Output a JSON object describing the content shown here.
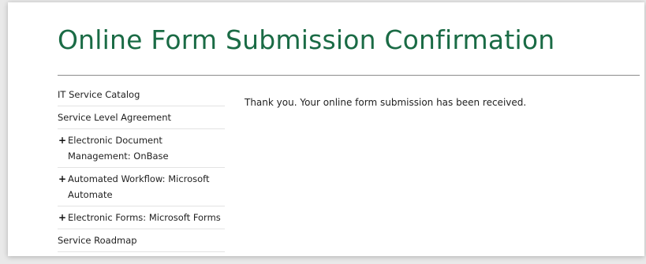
{
  "header": {
    "title": "Online Form Submission Confirmation",
    "accent_color": "#1a6b45"
  },
  "sidebar": {
    "items": [
      {
        "label": "IT Service Catalog",
        "expandable": false
      },
      {
        "label": "Service Level Agreement",
        "expandable": false
      },
      {
        "label": "Electronic Document Management: OnBase",
        "expandable": true,
        "icon": "plus-icon"
      },
      {
        "label": "Automated Workflow: Microsoft Automate",
        "expandable": true,
        "icon": "plus-icon"
      },
      {
        "label": "Electronic Forms: Microsoft Forms",
        "expandable": true,
        "icon": "plus-icon"
      },
      {
        "label": "Service Roadmap",
        "expandable": false
      }
    ]
  },
  "main": {
    "message": "Thank you. Your online form submission has been received."
  }
}
